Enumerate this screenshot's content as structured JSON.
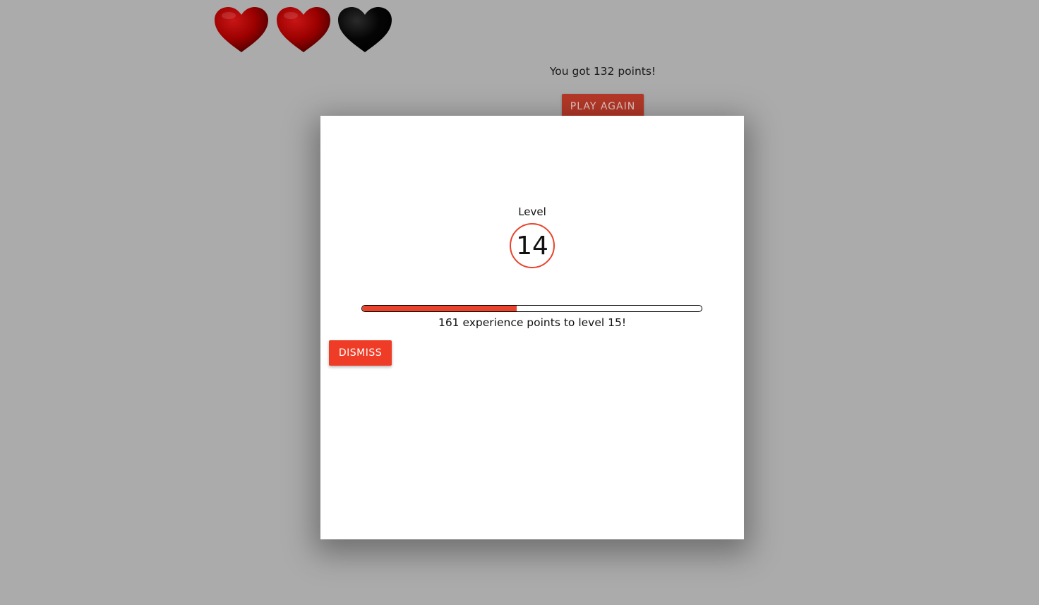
{
  "game": {
    "hearts": [
      {
        "state": "full",
        "color": "#9b0000",
        "icon": "heart-full-icon"
      },
      {
        "state": "full",
        "color": "#9b0000",
        "icon": "heart-full-icon"
      },
      {
        "state": "empty",
        "color": "#000000",
        "icon": "heart-empty-icon"
      }
    ],
    "score_text": "You got 132 points!",
    "play_again_label": "PLAY AGAIN"
  },
  "level_modal": {
    "level_label": "Level",
    "level_value": "14",
    "progress_fraction": 0.455,
    "xp_text": "161 experience points to level 15!",
    "dismiss_label": "DISMISS"
  },
  "colors": {
    "background": "#ababab",
    "accent": "#ee3c26",
    "play_again_bg": "#b53828",
    "heart_red": "#9b0000",
    "heart_black": "#000000"
  }
}
